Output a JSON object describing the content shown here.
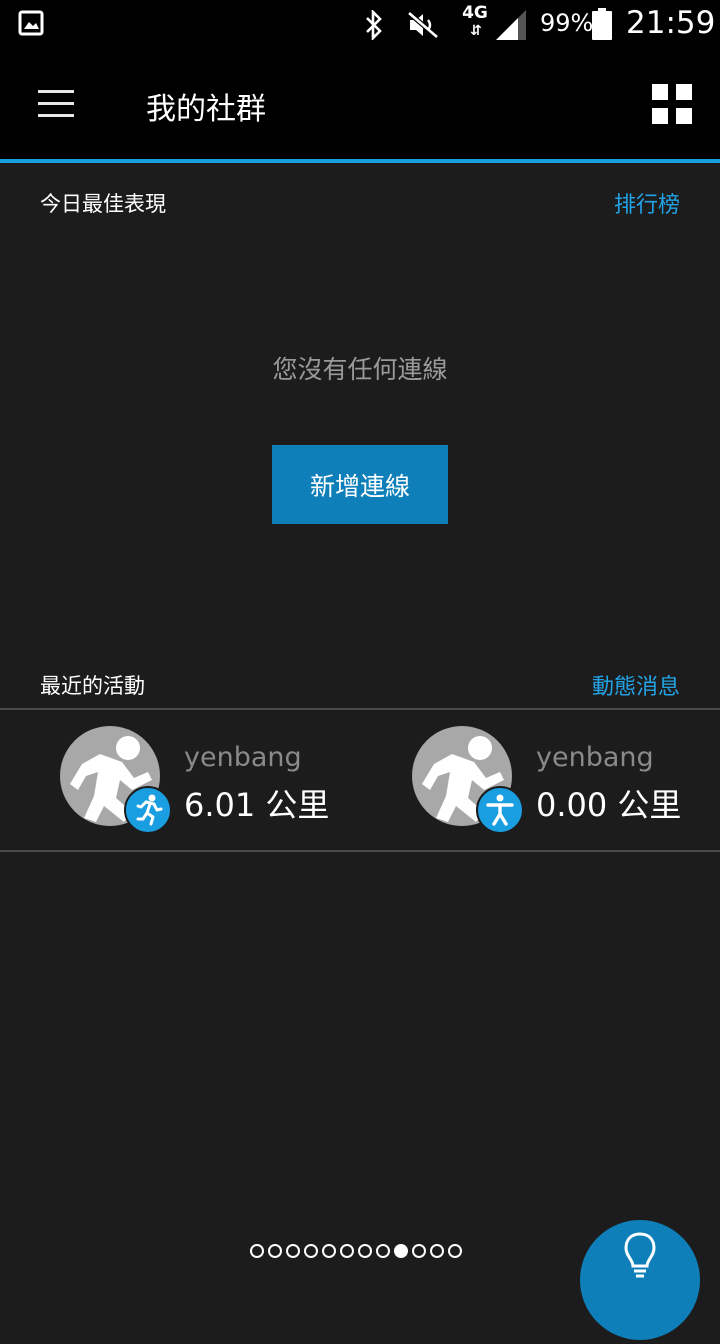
{
  "status_bar": {
    "network": "4G",
    "network_arrows": "⇵",
    "battery_percent": "99%",
    "time": "21:59",
    "icons": [
      "gallery-icon",
      "bluetooth-icon",
      "mute-icon",
      "signal-icon",
      "battery-icon"
    ]
  },
  "app_bar": {
    "title": "我的社群",
    "icons": [
      "menu-icon",
      "widgets-grid-icon"
    ]
  },
  "best_today": {
    "title": "今日最佳表現",
    "link": "排行榜",
    "empty_message": "您沒有任何連線",
    "add_button": "新增連線"
  },
  "recent": {
    "title": "最近的活動",
    "link": "動態消息",
    "items": [
      {
        "name": "yenbang",
        "distance": "6.01 公里",
        "activity_icon": "running-icon"
      },
      {
        "name": "yenbang",
        "distance": "0.00 公里",
        "activity_icon": "person-icon"
      }
    ]
  },
  "pager": {
    "total": 12,
    "active_index": 8
  },
  "fab": {
    "icon": "lightbulb-icon"
  },
  "colors": {
    "accent": "#1a9ee2",
    "button": "#0e7fb8",
    "background": "#1c1c1c"
  }
}
